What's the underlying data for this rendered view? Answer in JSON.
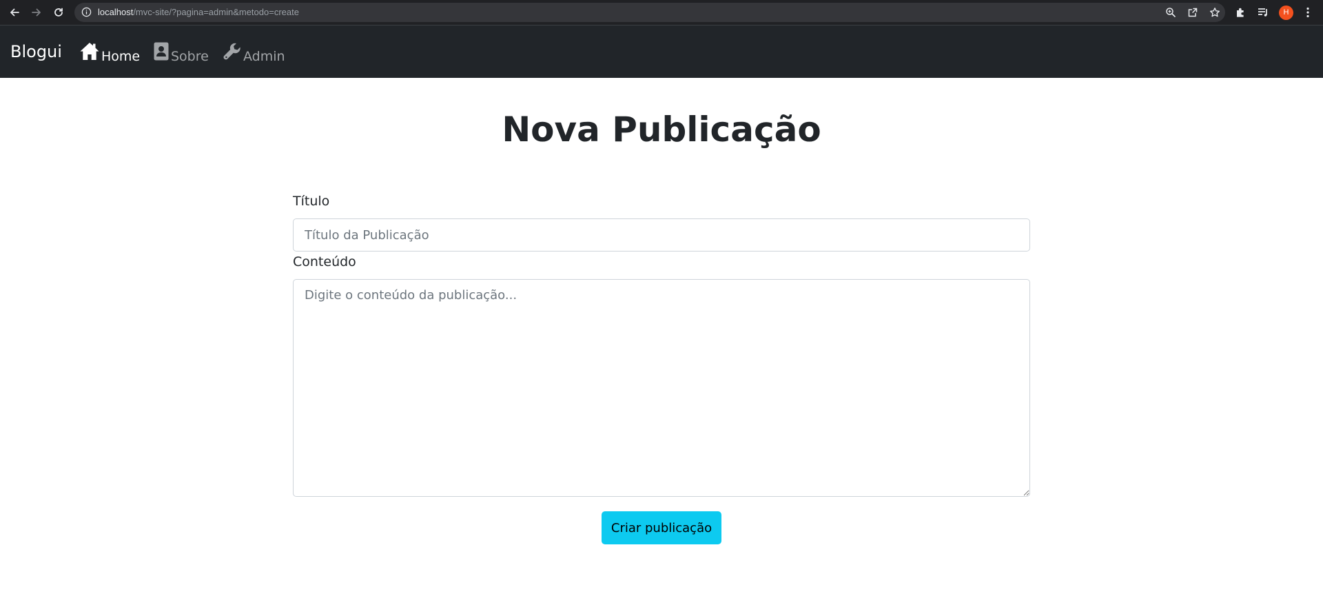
{
  "browser": {
    "url_host": "localhost",
    "url_path": "/mvc-site/?pagina=admin&metodo=create",
    "profile_initial": "H",
    "icons": [
      "back-icon",
      "forward-icon",
      "reload-icon",
      "info-icon",
      "zoom-icon",
      "share-icon",
      "star-icon",
      "extensions-icon",
      "reading-list-icon",
      "menu-icon"
    ]
  },
  "navbar": {
    "brand": "Blogui",
    "links": [
      {
        "label": "Home",
        "icon": "home-icon",
        "active": true
      },
      {
        "label": "Sobre",
        "icon": "contact-card-icon",
        "active": false
      },
      {
        "label": "Admin",
        "icon": "wrench-icon",
        "active": false
      }
    ]
  },
  "form": {
    "title": "Nova Publicação",
    "title_label": "Título",
    "title_placeholder": "Título da Publicação",
    "content_label": "Conteúdo",
    "content_placeholder": "Digite o conteúdo da publicação...",
    "submit_label": "Criar publicação"
  },
  "colors": {
    "navbar_bg": "#212529",
    "button_bg": "#0dcaf0",
    "text": "#212529"
  }
}
